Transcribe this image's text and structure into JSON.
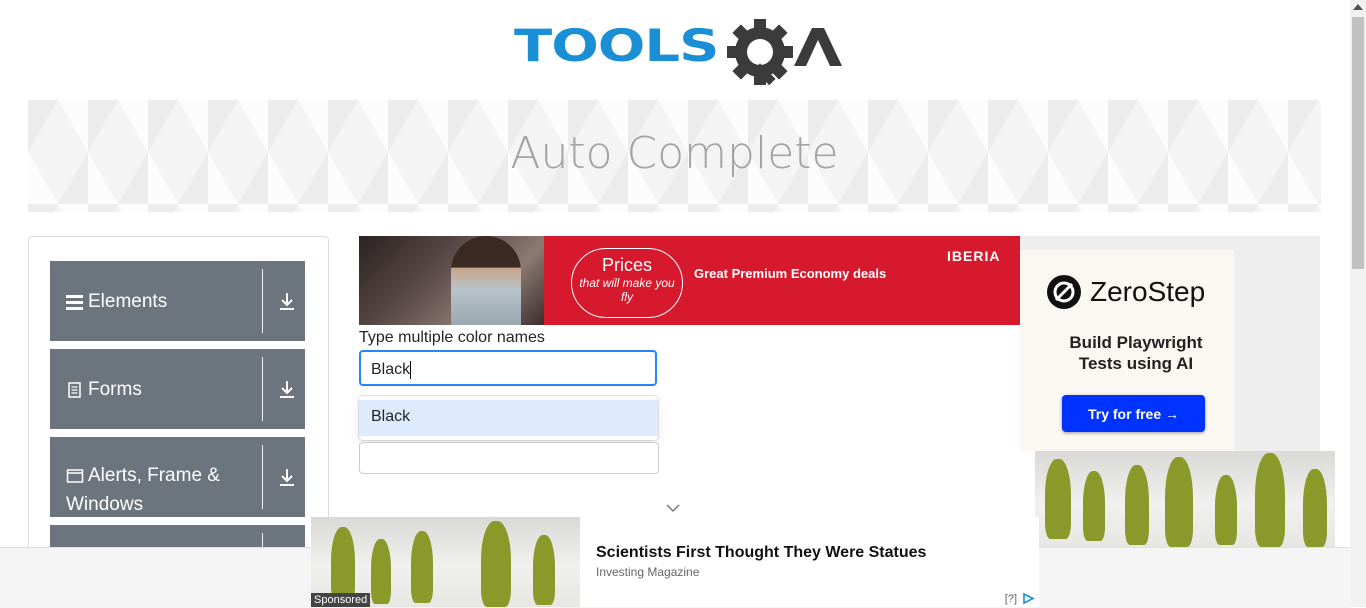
{
  "header": {
    "logo_tools": "TOOLS",
    "logo_qa": "QA"
  },
  "banner": {
    "title": "Auto Complete"
  },
  "sidebar": {
    "groups": [
      {
        "label": "Elements",
        "icon": "hamburger-icon"
      },
      {
        "label": "Forms",
        "icon": "document-icon"
      },
      {
        "label": "Alerts, Frame & Windows",
        "icon": "window-icon"
      },
      {
        "label": "",
        "icon": ""
      }
    ]
  },
  "ad_top": {
    "prices": "Prices",
    "tagline": "that will make you fly",
    "deal": "Great Premium Economy deals",
    "brand": "IBERIA"
  },
  "form": {
    "multi_label": "Type multiple color names",
    "multi_value": "Black",
    "option": "Black",
    "single_value": ""
  },
  "ad_right": {
    "brand": "ZeroStep",
    "headline_1": "Build Playwright",
    "headline_2": "Tests using AI",
    "cta": "Try for free →"
  },
  "ad_bottom": {
    "sponsored": "Sponsored",
    "title": "Scientists First Thought They Were Statues",
    "source": "Investing Magazine",
    "info": "[?]"
  },
  "colors": {
    "brand_blue": "#1a8fd6",
    "sidebar_group": "#6c757d",
    "input_focus": "#2684ff",
    "option_highlight": "#deebff",
    "iberia_red": "#d7192d",
    "cta_blue": "#0033ff"
  }
}
